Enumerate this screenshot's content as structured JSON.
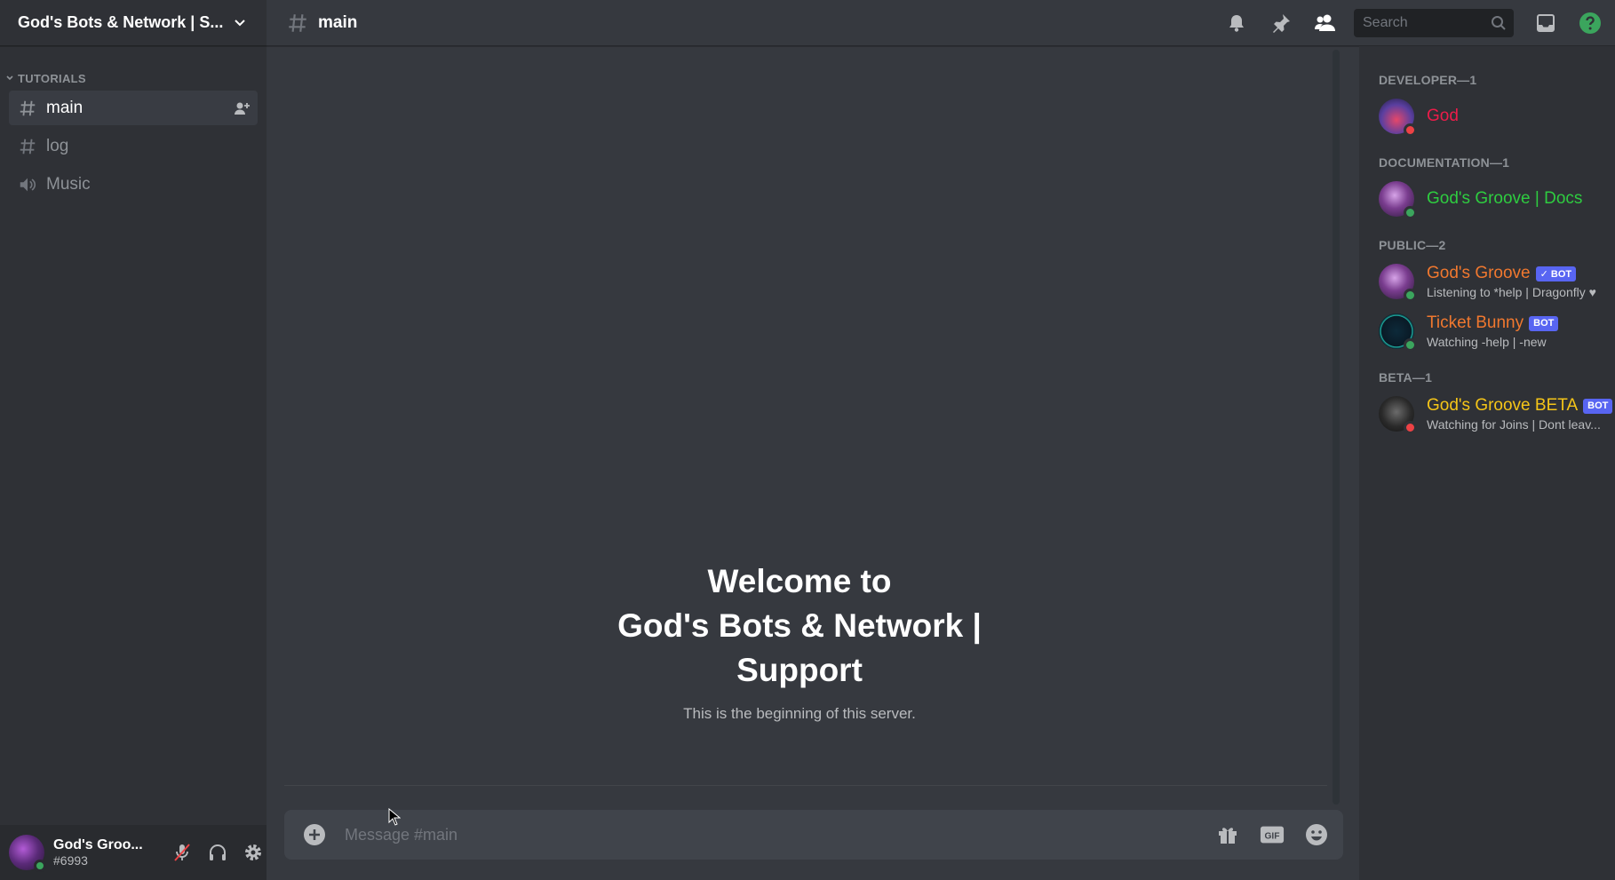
{
  "server": {
    "name": "God's Bots & Network | S..."
  },
  "sidebar": {
    "category": "TUTORIALS",
    "channels": [
      {
        "label": "main",
        "type": "text",
        "active": true
      },
      {
        "label": "log",
        "type": "text",
        "active": false
      },
      {
        "label": "Music",
        "type": "voice",
        "active": false
      }
    ]
  },
  "user_panel": {
    "name": "God's Groo...",
    "tag": "#6993"
  },
  "topbar": {
    "channel": "main",
    "search_placeholder": "Search"
  },
  "welcome": {
    "line1": "Welcome to",
    "line2": "God's Bots & Network |",
    "line3": "Support",
    "subtitle": "This is the beginning of this server."
  },
  "composer": {
    "placeholder": "Message #main"
  },
  "members": {
    "groups": [
      {
        "label": "DEVELOPER—1",
        "items": [
          {
            "name": "God",
            "color": "#ed1c4a",
            "status": "dnd",
            "bot": false,
            "activity": ""
          }
        ]
      },
      {
        "label": "DOCUMENTATION—1",
        "items": [
          {
            "name": "God's Groove | Docs",
            "color": "#2ecc40",
            "status": "online",
            "bot": false,
            "activity": ""
          }
        ]
      },
      {
        "label": "PUBLIC—2",
        "items": [
          {
            "name": "God's Groove",
            "color": "#f0782f",
            "status": "online",
            "bot": true,
            "bot_label": "✓ BOT",
            "activity": "Listening to *help | Dragonfly"
          },
          {
            "name": "Ticket Bunny",
            "color": "#f0782f",
            "status": "online",
            "bot": true,
            "bot_label": "BOT",
            "activity": "Watching -help | -new"
          }
        ]
      },
      {
        "label": "BETA—1",
        "items": [
          {
            "name": "God's Groove BETA",
            "color": "#f5c518",
            "status": "dnd",
            "bot": true,
            "bot_label": "BOT",
            "activity": "Watching for Joins | Dont leav..."
          }
        ]
      }
    ]
  },
  "colors": {
    "online": "#3ba55d",
    "dnd": "#ed4245",
    "blurple": "#5865f2"
  }
}
